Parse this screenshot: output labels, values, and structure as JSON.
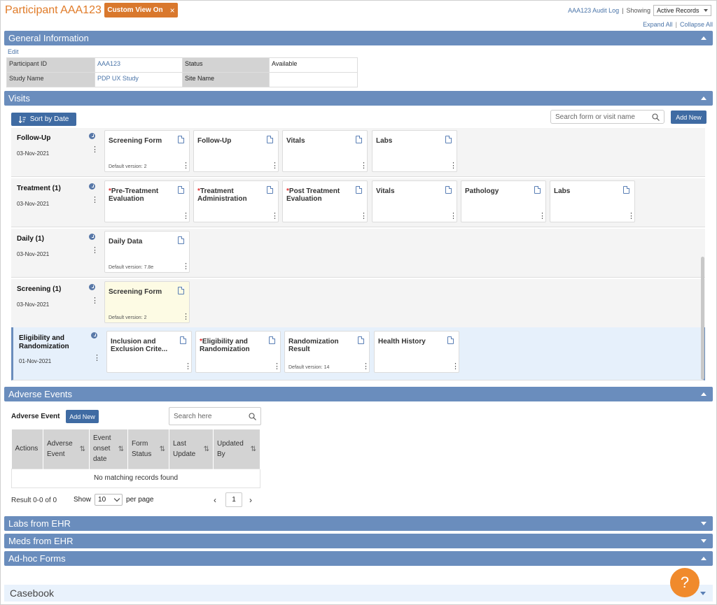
{
  "header": {
    "participant_title": "Participant AAA123",
    "custom_view_label": "Custom View On",
    "close_glyph": "×",
    "audit_log_link": "AAA123 Audit Log",
    "separator": "|",
    "showing_label": "Showing",
    "showing_value": "Active Records",
    "expand_all": "Expand All",
    "collapse_all": "Collapse All"
  },
  "general": {
    "title": "General Information",
    "edit_link": "Edit",
    "participant_id_label": "Participant ID",
    "participant_id_value": "AAA123",
    "status_label": "Status",
    "status_value": "Available",
    "study_name_label": "Study Name",
    "study_name_value": "PDP UX Study",
    "site_name_label": "Site Name",
    "site_name_value": ""
  },
  "visits": {
    "title": "Visits",
    "sort_label": "Sort by Date",
    "search_placeholder": "Search form or visit name",
    "add_new_label": "Add New",
    "rows": [
      {
        "name": "Follow-Up",
        "date": "03-Nov-2021",
        "forms": [
          {
            "title": "Screening Form",
            "required": false,
            "version": "Default version: 2"
          },
          {
            "title": "Follow-Up",
            "required": false,
            "version": ""
          },
          {
            "title": "Vitals",
            "required": false,
            "version": ""
          },
          {
            "title": "Labs",
            "required": false,
            "version": ""
          }
        ]
      },
      {
        "name": "Treatment (1)",
        "date": "03-Nov-2021",
        "forms": [
          {
            "title": "Pre-Treatment Evaluation",
            "required": true,
            "version": ""
          },
          {
            "title": "Treatment Administration",
            "required": true,
            "version": ""
          },
          {
            "title": "Post Treatment Evaluation",
            "required": true,
            "version": ""
          },
          {
            "title": "Vitals",
            "required": false,
            "version": ""
          },
          {
            "title": "Pathology",
            "required": false,
            "version": ""
          },
          {
            "title": "Labs",
            "required": false,
            "version": ""
          }
        ]
      },
      {
        "name": "Daily (1)",
        "date": "03-Nov-2021",
        "forms": [
          {
            "title": "Daily Data",
            "required": false,
            "version": "Default version: 7.8e"
          }
        ]
      },
      {
        "name": "Screening (1)",
        "date": "03-Nov-2021",
        "forms": [
          {
            "title": "Screening Form",
            "required": false,
            "version": "Default version: 2",
            "highlight": true
          }
        ]
      },
      {
        "name": "Eligibility and Randomization",
        "date": "01-Nov-2021",
        "selected": true,
        "forms": [
          {
            "title": "Inclusion and Exclusion Crite...",
            "required": false,
            "version": ""
          },
          {
            "title": "Eligibility and Randomization",
            "required": true,
            "version": ""
          },
          {
            "title": "Randomization Result",
            "required": false,
            "version": "Default version: 14"
          },
          {
            "title": "Health History",
            "required": false,
            "version": ""
          }
        ]
      }
    ]
  },
  "adverse": {
    "title": "Adverse Events",
    "label": "Adverse Event",
    "add_new_label": "Add New",
    "search_placeholder": "Search here",
    "columns": [
      "Actions",
      "Adverse Event",
      "Event onset date",
      "Form Status",
      "Last Update",
      "Updated By"
    ],
    "empty_message": "No matching records found",
    "result_text": "Result 0-0 of 0",
    "show_label": "Show",
    "page_size": "10",
    "per_page_label": "per page",
    "page_number": "1",
    "prev_glyph": "‹",
    "next_glyph": "›"
  },
  "sections": {
    "labs_ehr": "Labs from EHR",
    "meds_ehr": "Meds from EHR",
    "adhoc": "Ad-hoc Forms",
    "casebook": "Casebook"
  },
  "help_glyph": "?",
  "colors": {
    "accent_orange": "#e07b28",
    "section_bar": "#6a8dbd",
    "button_blue": "#3f6ba3",
    "required_red": "#e03030"
  }
}
